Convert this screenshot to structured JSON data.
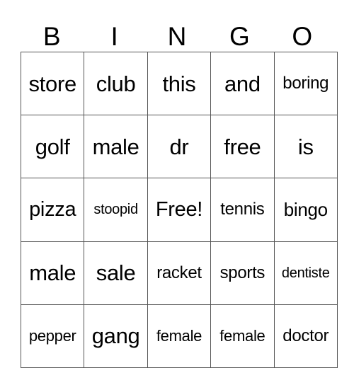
{
  "header": {
    "letters": [
      "B",
      "I",
      "N",
      "G",
      "O"
    ]
  },
  "board": {
    "rows": [
      [
        "store",
        "club",
        "this",
        "and",
        "boring"
      ],
      [
        "golf",
        "male",
        "dr",
        "free",
        "is"
      ],
      [
        "pizza",
        "stoopid",
        "Free!",
        "tennis",
        "bingo"
      ],
      [
        "male",
        "sale",
        "racket",
        "sports",
        "dentiste"
      ],
      [
        "pepper",
        "gang",
        "female",
        "female",
        "doctor"
      ]
    ],
    "free_space": "Free!"
  }
}
